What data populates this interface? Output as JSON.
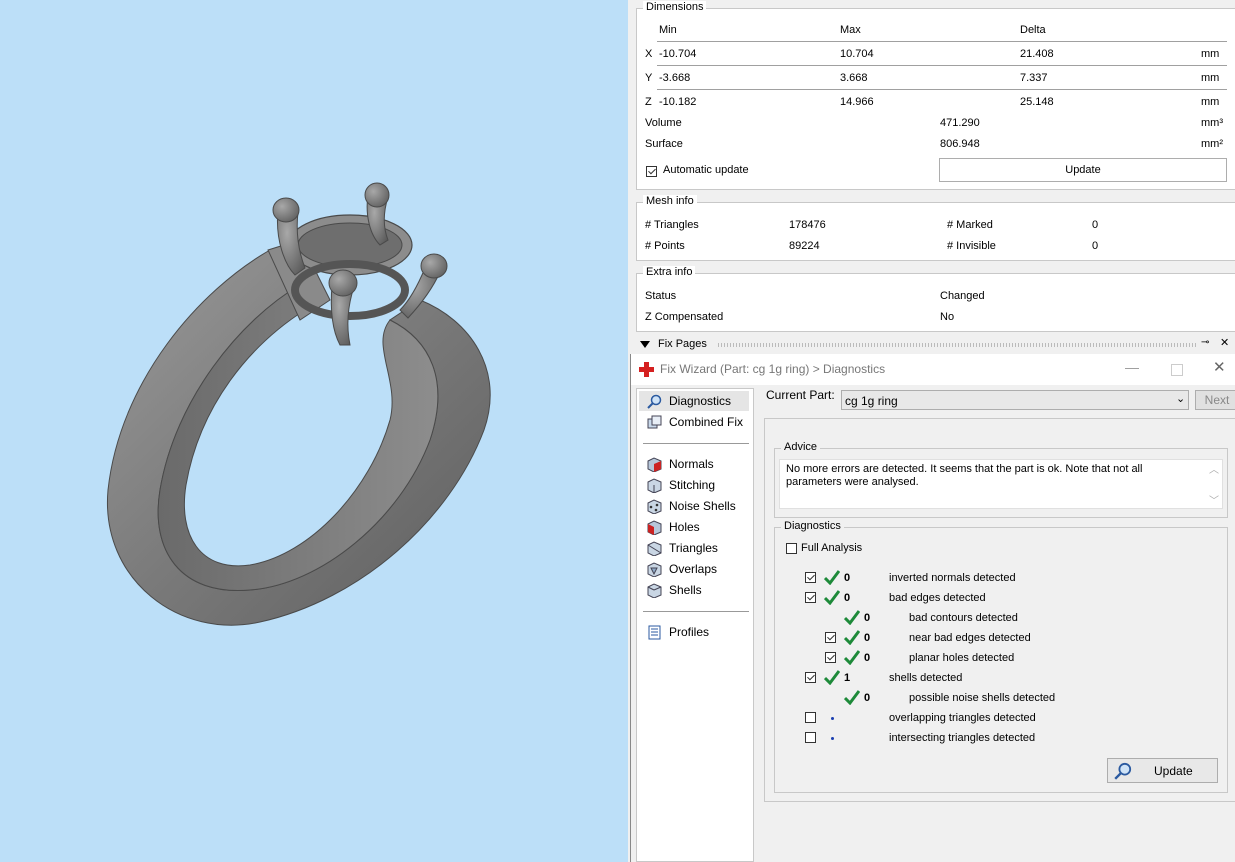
{
  "dimensions": {
    "title": "Dimensions",
    "headers": [
      "Min",
      "Max",
      "Delta"
    ],
    "rows": [
      {
        "axis": "X",
        "min": "-10.704",
        "max": "10.704",
        "delta": "21.408",
        "unit": "mm"
      },
      {
        "axis": "Y",
        "min": "-3.668",
        "max": "3.668",
        "delta": "7.337",
        "unit": "mm"
      },
      {
        "axis": "Z",
        "min": "-10.182",
        "max": "14.966",
        "delta": "25.148",
        "unit": "mm"
      }
    ],
    "volume_label": "Volume",
    "volume": "471.290",
    "volume_unit": "mm³",
    "surface_label": "Surface",
    "surface": "806.948",
    "surface_unit": "mm²",
    "auto_update_label": "Automatic update",
    "auto_update_checked": true,
    "update_button": "Update"
  },
  "mesh_info": {
    "title": "Mesh info",
    "triangles_label": "# Triangles",
    "triangles": "178476",
    "points_label": "# Points",
    "points": "89224",
    "marked_label": "# Marked",
    "marked": "0",
    "invisible_label": "# Invisible",
    "invisible": "0"
  },
  "extra_info": {
    "title": "Extra info",
    "status_label": "Status",
    "status": "Changed",
    "zcomp_label": "Z Compensated",
    "zcomp": "No"
  },
  "fix_pages": {
    "label": "Fix Pages"
  },
  "wizard": {
    "title": "Fix Wizard (Part: cg 1g ring) > Diagnostics",
    "nav": [
      {
        "label": "Diagnostics",
        "icon": "magnifier-icon"
      },
      {
        "label": "Combined Fix",
        "icon": "combined-fix-icon"
      },
      {
        "label": "Normals",
        "icon": "normals-icon"
      },
      {
        "label": "Stitching",
        "icon": "stitching-icon"
      },
      {
        "label": "Noise Shells",
        "icon": "noise-shells-icon"
      },
      {
        "label": "Holes",
        "icon": "holes-icon"
      },
      {
        "label": "Triangles",
        "icon": "triangles-icon"
      },
      {
        "label": "Overlaps",
        "icon": "overlaps-icon"
      },
      {
        "label": "Shells",
        "icon": "shells-icon"
      },
      {
        "label": "Profiles",
        "icon": "profiles-icon"
      }
    ],
    "current_part_label": "Current Part:",
    "current_part_value": "cg 1g ring",
    "next_button": "Next",
    "advice_title": "Advice",
    "advice_text": "No more errors are detected. It seems that the part is ok. Note that not all parameters were analysed.",
    "diag_title": "Diagnostics",
    "full_analysis_label": "Full Analysis",
    "full_analysis_checked": false,
    "diagnostics": [
      {
        "checkbox": true,
        "checked": true,
        "status": "ok",
        "count": "0",
        "label": "inverted normals detected",
        "indent": 0
      },
      {
        "checkbox": true,
        "checked": true,
        "status": "ok",
        "count": "0",
        "label": "bad edges detected",
        "indent": 0
      },
      {
        "checkbox": false,
        "checked": false,
        "status": "ok",
        "count": "0",
        "label": "bad contours detected",
        "indent": 1
      },
      {
        "checkbox": true,
        "checked": true,
        "status": "ok",
        "count": "0",
        "label": "near bad edges detected",
        "indent": 1
      },
      {
        "checkbox": true,
        "checked": true,
        "status": "ok",
        "count": "0",
        "label": "planar holes detected",
        "indent": 1
      },
      {
        "checkbox": true,
        "checked": true,
        "status": "ok",
        "count": "1",
        "label": "shells detected",
        "indent": 0
      },
      {
        "checkbox": false,
        "checked": false,
        "status": "ok",
        "count": "0",
        "label": "possible noise shells detected",
        "indent": 1
      },
      {
        "checkbox": true,
        "checked": false,
        "status": "pending",
        "count": "",
        "label": "overlapping triangles detected",
        "indent": 0
      },
      {
        "checkbox": true,
        "checked": false,
        "status": "pending",
        "count": "",
        "label": "intersecting triangles detected",
        "indent": 0
      }
    ],
    "update_button": "Update"
  },
  "colors": {
    "viewport_bg": "#bcdff8",
    "tick_green": "#1e8a3a",
    "ring_gray": "#808080"
  }
}
